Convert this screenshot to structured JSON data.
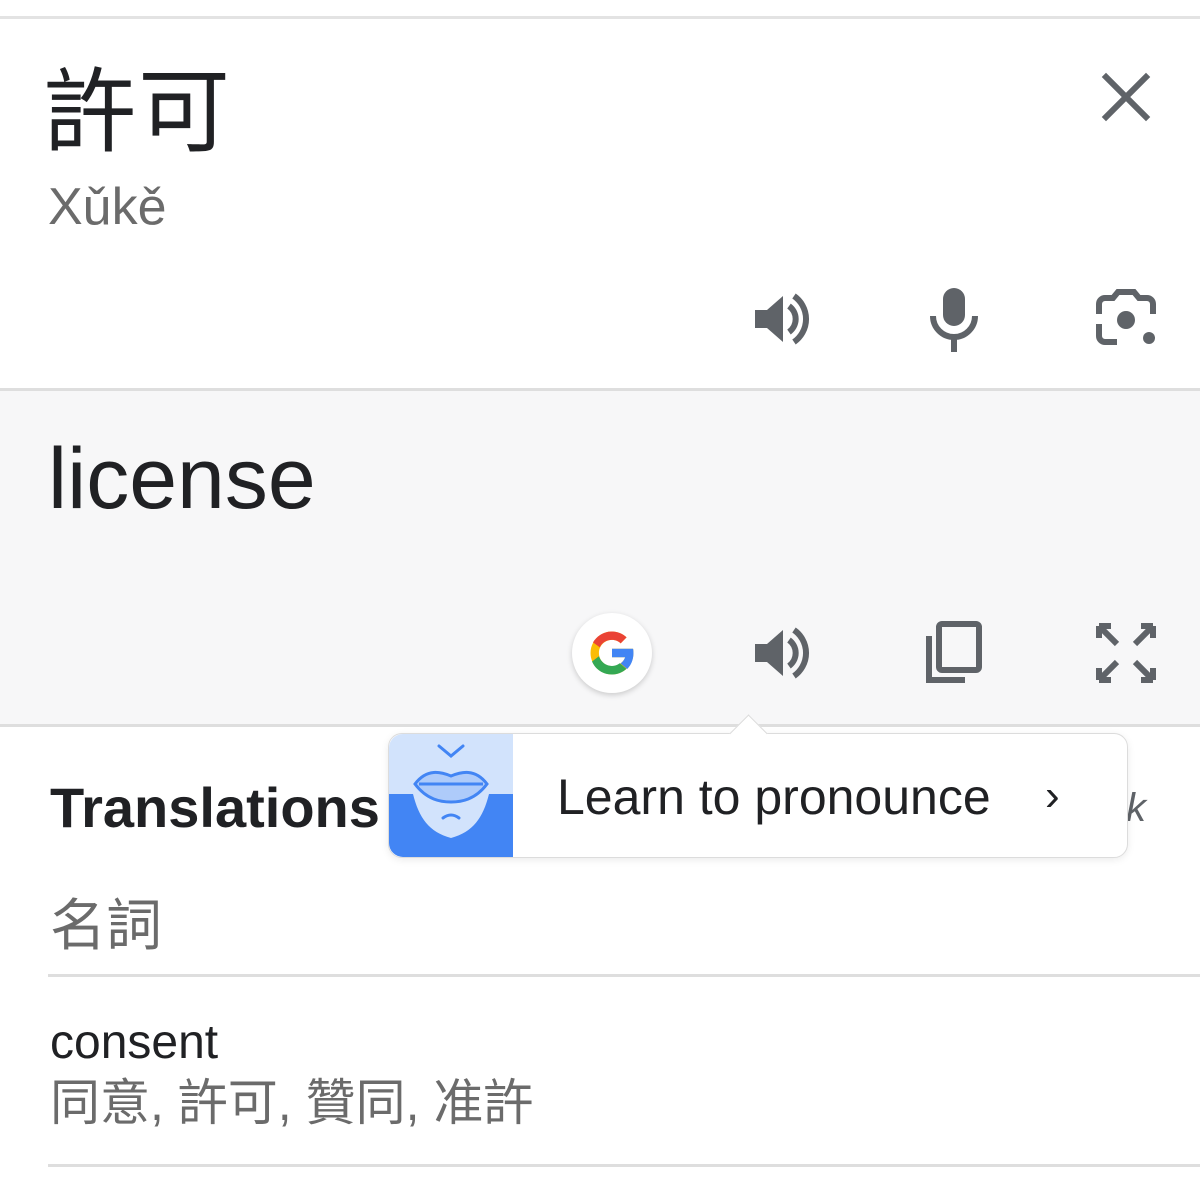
{
  "source": {
    "text": "許可",
    "transliteration": "Xǔkě",
    "actions": [
      "speaker-icon",
      "microphone-icon",
      "camera-icon"
    ]
  },
  "result": {
    "text": "license",
    "actions": [
      "google-icon",
      "speaker-icon",
      "copy-icon",
      "fullscreen-icon"
    ]
  },
  "tooltip": {
    "label": "Learn to pronounce",
    "chevron": "›"
  },
  "translations": {
    "header": "Translations",
    "header_trailing": "k",
    "part_of_speech": "名詞",
    "entries": [
      {
        "word": "consent",
        "synonyms": "同意, 許可, 贊同, 准許"
      }
    ]
  },
  "colors": {
    "icon_gray": "#5f6368",
    "google_blue": "#4285F4",
    "google_red": "#EA4335",
    "google_yellow": "#FBBC05",
    "google_green": "#34A853",
    "result_bg": "#f7f7f8"
  }
}
